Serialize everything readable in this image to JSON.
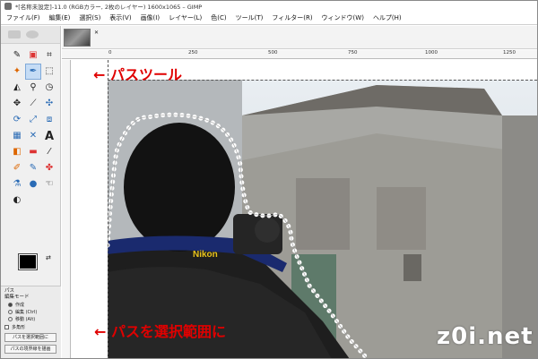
{
  "window": {
    "title": "*[名称未設定]-11.0 (RGBカラー, 2枚のレイヤー) 1600x1065 – GIMP"
  },
  "menu": [
    "ファイル(F)",
    "編集(E)",
    "選択(S)",
    "表示(V)",
    "画像(I)",
    "レイヤー(L)",
    "色(C)",
    "ツール(T)",
    "フィルター(R)",
    "ウィンドウ(W)",
    "ヘルプ(H)"
  ],
  "ruler": {
    "labels": [
      "0",
      "250",
      "500",
      "750",
      "1000",
      "1250"
    ]
  },
  "tools": [
    "rect-select-icon",
    "ellipse-select-icon",
    "free-select-icon",
    "move-icon",
    "align-icon",
    "crop-icon",
    "fuzzy-select-icon",
    "paths-icon",
    "zoom-icon",
    "measure-icon",
    "transform-icon",
    "rotate-icon",
    "scale-icon",
    "shear-icon",
    "perspective-icon",
    "flip-icon",
    "cage-icon",
    "text-icon",
    "bucket-fill-icon",
    "gradient-icon",
    "paintbrush-icon",
    "pencil-icon",
    "airbrush-icon",
    "ink-icon",
    "clone-icon",
    "heal-icon",
    "smudge-icon",
    "blur-icon",
    "dodge-icon",
    "color-picker-icon",
    "mypaint-icon"
  ],
  "tool_options": {
    "heading": "パス",
    "mode_label": "編集モード",
    "modes": [
      "作成",
      "編集 (Ctrl)",
      "移動 (Alt)"
    ],
    "polygonal": "多角形",
    "button_path_to_selection": "パスを選択範囲に",
    "button_stroke_path": "パスの境界線を描画"
  },
  "annotations": {
    "path_tool": "← パスツール",
    "path_to_selection": "← パスを選択範囲に"
  },
  "watermark": "z0i.net",
  "colors": {
    "accent": "#e00000",
    "selected_tool": "#c5dcf5"
  }
}
